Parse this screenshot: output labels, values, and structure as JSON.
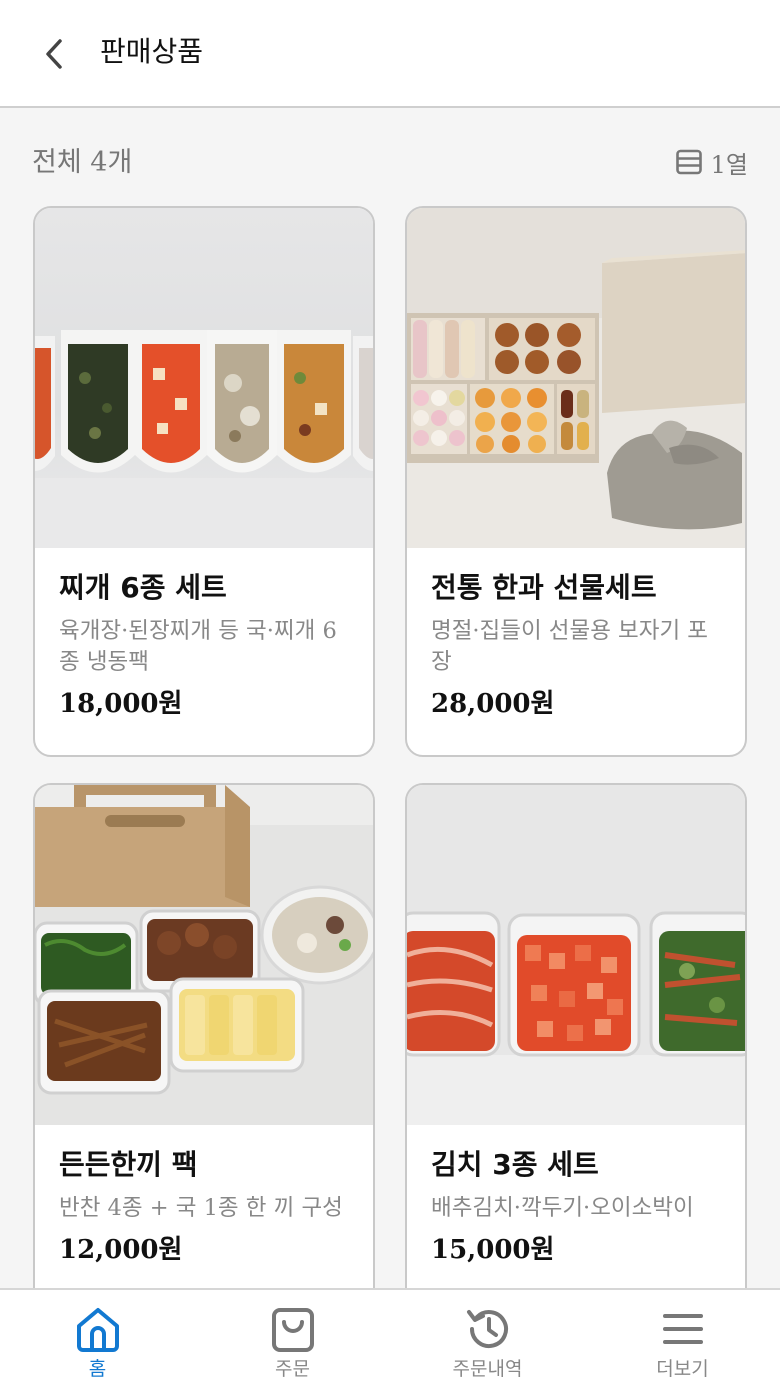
{
  "header": {
    "title": "판매상품"
  },
  "summary": {
    "count_label": "전체 4개",
    "view_toggle_label": "1열"
  },
  "products": [
    {
      "title": "찌개 6종 세트",
      "description": "육개장·된장찌개 등 국·찌개 6종 냉동팩",
      "price": "18,000원",
      "image": "soup-pouches"
    },
    {
      "title": "전통 한과 선물세트",
      "description": "명절·집들이 선물용 보자기 포장",
      "price": "28,000원",
      "image": "hangwa-box"
    },
    {
      "title": "든든한끼 팩",
      "description": "반찬 4종 + 국 1종 한 끼 구성",
      "price": "12,000원",
      "image": "banchan-containers"
    },
    {
      "title": "김치 3종 세트",
      "description": "배추김치·깍두기·오이소박이",
      "price": "15,000원",
      "image": "kimchi-jars"
    }
  ],
  "tabbar": {
    "items": [
      {
        "label": "홈",
        "icon": "home-icon",
        "active": true
      },
      {
        "label": "주문",
        "icon": "shopping-bag-icon",
        "active": false
      },
      {
        "label": "주문내역",
        "icon": "history-icon",
        "active": false
      },
      {
        "label": "더보기",
        "icon": "menu-icon",
        "active": false
      }
    ]
  },
  "colors": {
    "accent": "#1279d1",
    "muted_text": "#888888",
    "background": "#f5f5f5",
    "border": "#c9c9c9"
  }
}
